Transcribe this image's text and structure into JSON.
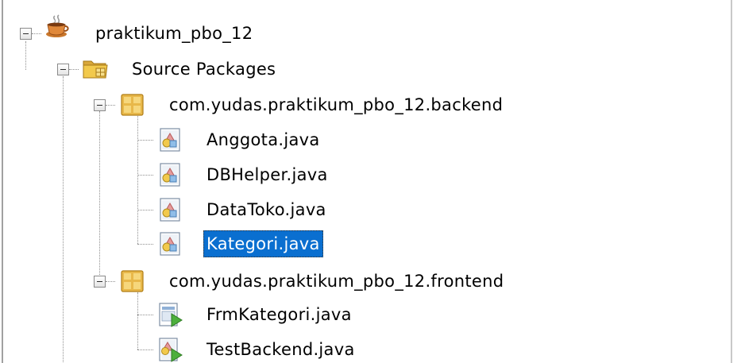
{
  "tree": {
    "project": {
      "name": "praktikum_pbo_12",
      "expanded": true,
      "source_packages": {
        "name": "Source Packages",
        "expanded": true,
        "packages": [
          {
            "name": "com.yudas.praktikum_pbo_12.backend",
            "expanded": true,
            "files": [
              {
                "name": "Anggota.java",
                "icon": "java-class-icon"
              },
              {
                "name": "DBHelper.java",
                "icon": "java-class-icon"
              },
              {
                "name": "DataToko.java",
                "icon": "java-class-icon"
              },
              {
                "name": "Kategori.java",
                "icon": "java-class-icon",
                "selected": true
              }
            ]
          },
          {
            "name": "com.yudas.praktikum_pbo_12.frontend",
            "expanded": true,
            "files": [
              {
                "name": "FrmKategori.java",
                "icon": "java-form-runnable-icon"
              },
              {
                "name": "TestBackend.java",
                "icon": "java-class-runnable-icon"
              }
            ]
          }
        ]
      }
    }
  },
  "colors": {
    "selection_bg": "#0a6fd0",
    "selection_text": "#ffffff",
    "package_icon": "#e8b84a",
    "folder_icon": "#f2c94c"
  }
}
